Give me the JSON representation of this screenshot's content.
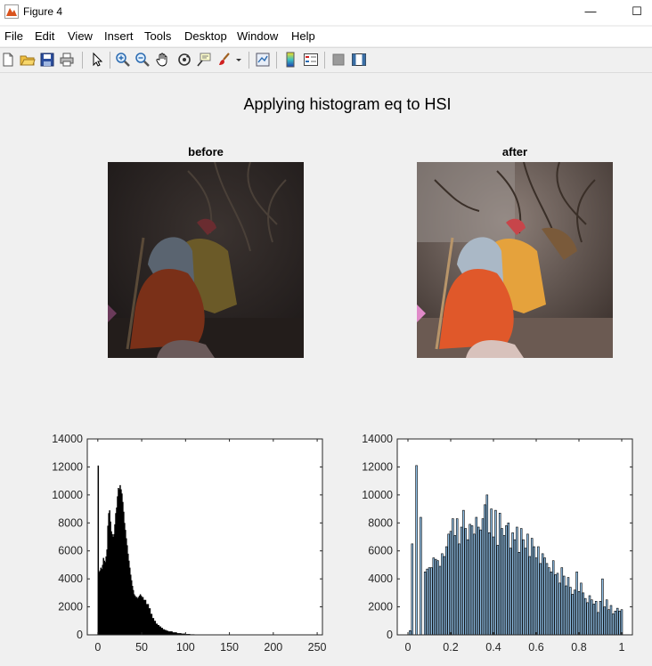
{
  "window": {
    "title": "Figure 4",
    "minimize": "—",
    "maximize": "☐"
  },
  "menu": [
    "File",
    "Edit",
    "View",
    "Insert",
    "Tools",
    "Desktop",
    "Window",
    "Help"
  ],
  "toolbar_icons": [
    "new-file-icon",
    "open-folder-icon",
    "save-icon",
    "print-icon",
    "pointer-icon",
    "zoom-in-icon",
    "zoom-out-icon",
    "pan-icon",
    "rotate-3d-icon",
    "data-cursor-icon",
    "brush-icon",
    "link-plot-icon",
    "colorbar-icon",
    "legend-icon",
    "hide-plot-tools-icon",
    "show-plot-tools-icon"
  ],
  "figure": {
    "title": "Applying histogram eq to HSI"
  },
  "images": {
    "before_title": "before",
    "after_title": "after"
  },
  "colors": {
    "left_hist": "#000000",
    "right_hist_fill": "#8fbfe6",
    "right_hist_edge": "#000000"
  },
  "chart_data": [
    {
      "type": "bar",
      "title": "",
      "xlabel": "",
      "ylabel": "",
      "xlim": [
        -12,
        256
      ],
      "ylim": [
        0,
        14000
      ],
      "xticks": [
        0,
        50,
        100,
        150,
        200,
        250
      ],
      "yticks": [
        0,
        2000,
        4000,
        6000,
        8000,
        10000,
        12000,
        14000
      ],
      "x": [
        0,
        1,
        2,
        3,
        4,
        5,
        6,
        7,
        8,
        9,
        10,
        11,
        12,
        13,
        14,
        15,
        16,
        17,
        18,
        19,
        20,
        21,
        22,
        23,
        24,
        25,
        26,
        27,
        28,
        29,
        30,
        31,
        32,
        33,
        34,
        35,
        36,
        37,
        38,
        39,
        40,
        41,
        42,
        43,
        44,
        45,
        46,
        47,
        48,
        49,
        50,
        52,
        55,
        58,
        60,
        62,
        64,
        66,
        68,
        70,
        72,
        74,
        76,
        78,
        80,
        85,
        90,
        95,
        100,
        105,
        110,
        115,
        120
      ],
      "values": [
        12100,
        4500,
        4600,
        4800,
        4700,
        5000,
        5500,
        5300,
        5200,
        5600,
        6100,
        7800,
        8700,
        8900,
        8100,
        7400,
        7200,
        7000,
        7200,
        7900,
        8700,
        9100,
        9900,
        10500,
        10400,
        10700,
        10400,
        10100,
        9500,
        8800,
        8000,
        7500,
        6900,
        6400,
        5800,
        5300,
        4800,
        4300,
        3900,
        3500,
        3200,
        2900,
        2800,
        2700,
        2700,
        2600,
        2700,
        2800,
        2900,
        2800,
        2700,
        2500,
        2200,
        1900,
        1500,
        1200,
        1000,
        800,
        700,
        600,
        500,
        400,
        350,
        300,
        250,
        180,
        120,
        90,
        60,
        40,
        20,
        10,
        0
      ]
    },
    {
      "type": "bar",
      "title": "",
      "xlabel": "",
      "ylabel": "",
      "xlim": [
        -0.05,
        1.05
      ],
      "ylim": [
        0,
        14000
      ],
      "xticks": [
        0,
        0.2,
        0.4,
        0.6,
        0.8,
        1
      ],
      "yticks": [
        0,
        2000,
        4000,
        6000,
        8000,
        10000,
        12000,
        14000
      ],
      "x": [
        0.01,
        0.02,
        0.03,
        0.04,
        0.05,
        0.06,
        0.07,
        0.08,
        0.09,
        0.1,
        0.11,
        0.12,
        0.13,
        0.14,
        0.15,
        0.16,
        0.17,
        0.18,
        0.19,
        0.2,
        0.21,
        0.22,
        0.23,
        0.24,
        0.25,
        0.26,
        0.27,
        0.28,
        0.29,
        0.3,
        0.31,
        0.32,
        0.33,
        0.34,
        0.35,
        0.36,
        0.37,
        0.38,
        0.39,
        0.4,
        0.41,
        0.42,
        0.43,
        0.44,
        0.45,
        0.46,
        0.47,
        0.48,
        0.49,
        0.5,
        0.51,
        0.52,
        0.53,
        0.54,
        0.55,
        0.56,
        0.57,
        0.58,
        0.59,
        0.6,
        0.61,
        0.62,
        0.63,
        0.64,
        0.65,
        0.66,
        0.67,
        0.68,
        0.69,
        0.7,
        0.71,
        0.72,
        0.73,
        0.74,
        0.75,
        0.76,
        0.77,
        0.78,
        0.79,
        0.8,
        0.81,
        0.82,
        0.83,
        0.84,
        0.85,
        0.86,
        0.87,
        0.88,
        0.89,
        0.9,
        0.91,
        0.92,
        0.93,
        0.94,
        0.95,
        0.96,
        0.97,
        0.98,
        0.99,
        1.0
      ],
      "values": [
        300,
        6500,
        0,
        12100,
        0,
        8400,
        0,
        4500,
        4700,
        4800,
        4800,
        5500,
        5400,
        5300,
        4900,
        5800,
        5600,
        6300,
        7200,
        7400,
        8300,
        7100,
        8300,
        6500,
        7700,
        8900,
        7600,
        6800,
        7900,
        7800,
        7200,
        8400,
        7700,
        7500,
        8300,
        9300,
        10000,
        7300,
        9000,
        7000,
        8900,
        6400,
        8700,
        7600,
        7100,
        7800,
        8000,
        6200,
        7300,
        6800,
        7700,
        5900,
        7600,
        6800,
        6200,
        7200,
        5600,
        6900,
        6300,
        5500,
        6300,
        5100,
        5800,
        5500,
        5100,
        4800,
        4500,
        5300,
        4300,
        4400,
        3700,
        4800,
        4200,
        3500,
        4100,
        3400,
        2900,
        3200,
        4500,
        3100,
        3700,
        3000,
        2600,
        2300,
        2800,
        2500,
        2200,
        2400,
        1600,
        2400,
        4000,
        2000,
        2500,
        1800,
        2100,
        1500,
        1700,
        1900,
        1700,
        1800
      ]
    }
  ]
}
